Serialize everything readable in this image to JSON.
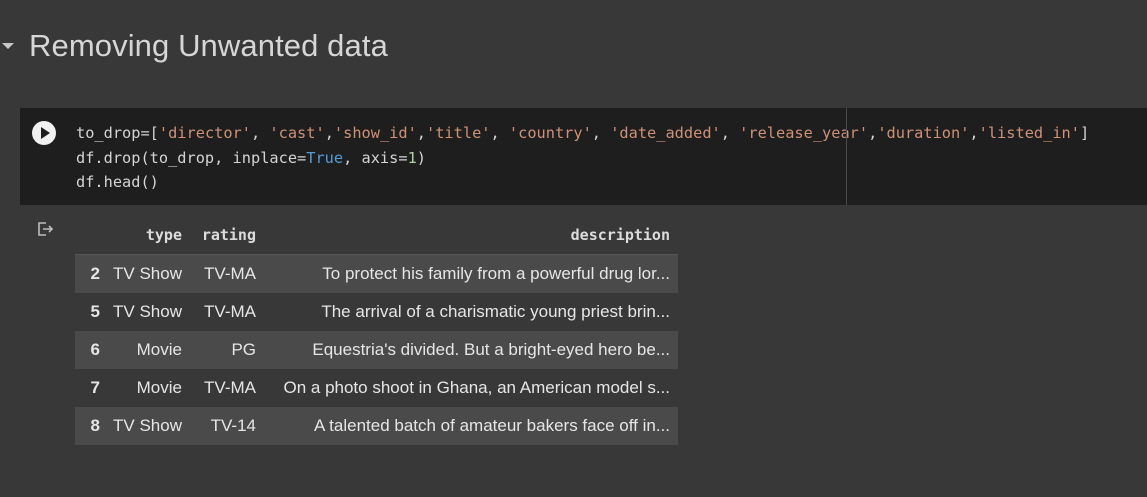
{
  "section": {
    "title": "Removing Unwanted data"
  },
  "code_cell": {
    "line1_prefix": "to_drop=[",
    "line1_items": [
      "'director'",
      "'cast'",
      "'show_id'",
      "'title'",
      "'country'",
      "'date_added'",
      "'release_year'",
      "'duration'",
      "'listed_in'"
    ],
    "line2_a": "df.drop(to_drop, inplace=",
    "line2_true": "True",
    "line2_b": ", axis=",
    "line2_num": "1",
    "line2_c": ")",
    "line3": "df.head()"
  },
  "output": {
    "columns": [
      "type",
      "rating",
      "description"
    ],
    "rows": [
      {
        "index": "2",
        "type": "TV Show",
        "rating": "TV-MA",
        "description": "To protect his family from a powerful drug lor..."
      },
      {
        "index": "5",
        "type": "TV Show",
        "rating": "TV-MA",
        "description": "The arrival of a charismatic young priest brin..."
      },
      {
        "index": "6",
        "type": "Movie",
        "rating": "PG",
        "description": "Equestria's divided. But a bright-eyed hero be..."
      },
      {
        "index": "7",
        "type": "Movie",
        "rating": "TV-MA",
        "description": "On a photo shoot in Ghana, an American model s..."
      },
      {
        "index": "8",
        "type": "TV Show",
        "rating": "TV-14",
        "description": "A talented batch of amateur bakers face off in..."
      }
    ]
  },
  "icons": {
    "collapse": "chevron-down-icon",
    "run": "play-icon",
    "output": "output-arrow-icon"
  },
  "colors": {
    "background": "#383838",
    "code_background": "#1e1e1e",
    "string": "#ce9178",
    "keyword": "#569cd6",
    "number": "#b5cea8"
  }
}
